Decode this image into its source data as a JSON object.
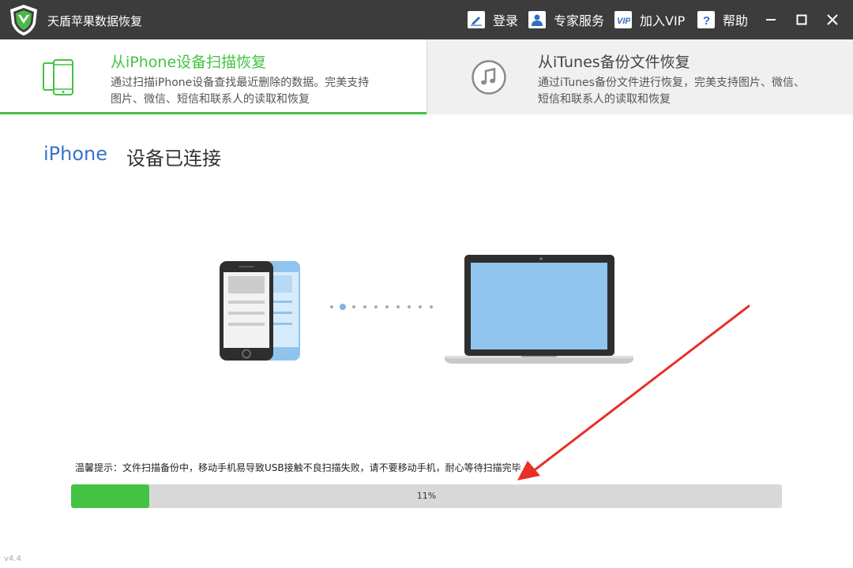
{
  "app": {
    "title": "天盾苹果数据恢复",
    "version": "v4.4"
  },
  "toolbar": {
    "login": "登录",
    "expert": "专家服务",
    "vip": "加入VIP",
    "help": "帮助"
  },
  "tabs": {
    "iphone": {
      "title": "从iPhone设备扫描恢复",
      "desc": "通过扫描iPhone设备查找最近删除的数据。完美支持图片、微信、短信和联系人的读取和恢复"
    },
    "itunes": {
      "title": "从iTunes备份文件恢复",
      "desc": "通过iTunes备份文件进行恢复，完美支持图片、微信、短信和联系人的读取和恢复"
    }
  },
  "status": {
    "device": "iPhone",
    "state": "设备已连接"
  },
  "tip": "温馨提示：文件扫描备份中，移动手机易导致USB接触不良扫描失败，请不要移动手机，耐心等待扫描完毕",
  "progress": {
    "percent": 11,
    "label": "11%"
  },
  "colors": {
    "accent": "#44c342",
    "titlebar": "#3c3c3c",
    "device_blue": "#3a73c9",
    "arrow": "#e8302a",
    "screen_blue": "#8fc4ee"
  },
  "icons": [
    "shield-logo-icon",
    "login-icon",
    "expert-icon",
    "vip-icon",
    "help-icon",
    "minimize-icon",
    "maximize-icon",
    "close-icon",
    "phone-icon",
    "music-note-icon"
  ]
}
